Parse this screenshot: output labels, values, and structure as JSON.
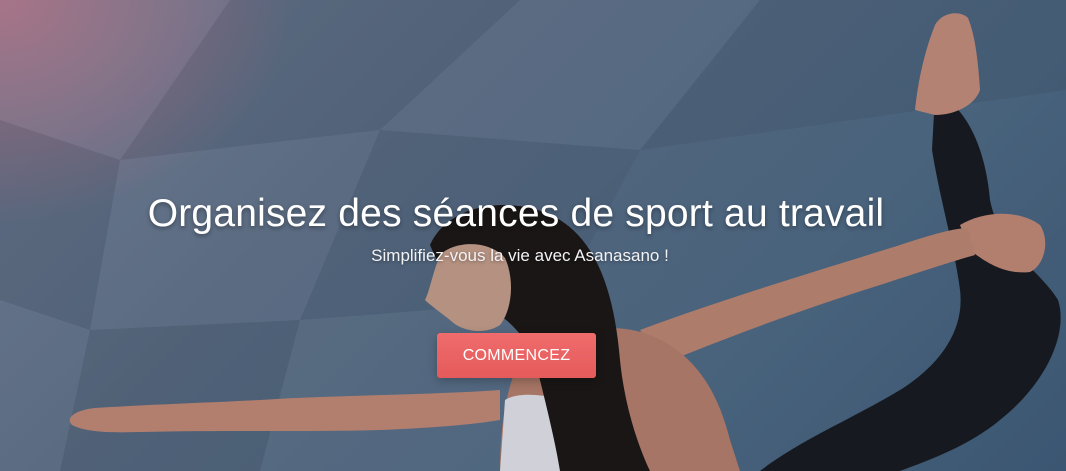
{
  "hero": {
    "headline": "Organisez des séances de sport au travail",
    "subtitle": "Simplifiez-vous la vie avec Asanasano !",
    "cta_label": "COMMENCEZ"
  },
  "colors": {
    "cta": "#e85f60",
    "text": "#ffffff",
    "background": "#5a6b82"
  }
}
